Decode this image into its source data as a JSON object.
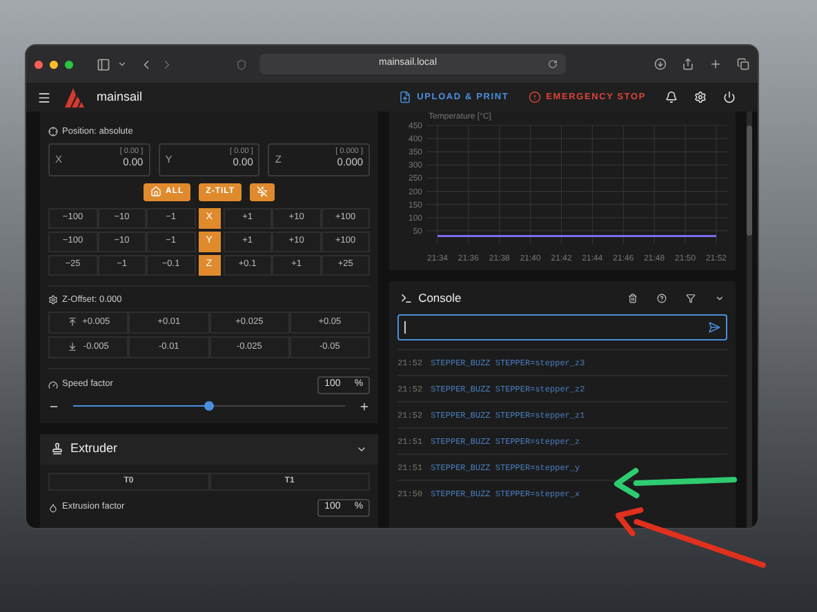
{
  "browser": {
    "url": "mainsail.local"
  },
  "app_bar": {
    "brand": "mainsail",
    "actions": [
      {
        "label": "UPLOAD & PRINT",
        "kind": "upload"
      },
      {
        "label": "EMERGENCY STOP",
        "kind": "stop"
      }
    ]
  },
  "toolhead": {
    "position_label": "Position: absolute",
    "axes": [
      {
        "label": "X",
        "target": "[ 0.00 ]",
        "value": "0.00"
      },
      {
        "label": "Y",
        "target": "[ 0.00 ]",
        "value": "0.00"
      },
      {
        "label": "Z",
        "target": "[ 0.000 ]",
        "value": "0.000"
      }
    ],
    "home_buttons": [
      {
        "kind": "home",
        "label": "ALL"
      },
      {
        "kind": "text",
        "label": "Z-TILT"
      },
      {
        "kind": "motors-off"
      }
    ],
    "jog_rows": [
      {
        "axis": "X",
        "minus": [
          "−100",
          "−10",
          "−1"
        ],
        "plus": [
          "+1",
          "+10",
          "+100"
        ]
      },
      {
        "axis": "Y",
        "minus": [
          "−100",
          "−10",
          "−1"
        ],
        "plus": [
          "+1",
          "+10",
          "+100"
        ]
      },
      {
        "axis": "Z",
        "minus": [
          "−25",
          "−1",
          "−0.1"
        ],
        "plus": [
          "+0.1",
          "+1",
          "+25"
        ]
      }
    ]
  },
  "z_offset": {
    "label": "Z-Offset: 0.000",
    "rows": [
      {
        "kind": "up",
        "steps": [
          "+0.005",
          "+0.01",
          "+0.025",
          "+0.05"
        ]
      },
      {
        "kind": "down",
        "steps": [
          "-0.005",
          "-0.01",
          "-0.025",
          "-0.05"
        ]
      }
    ]
  },
  "speed_factor": {
    "label": "Speed factor",
    "value": "100",
    "unit": "%",
    "level": 0.5
  },
  "extruder": {
    "title": "Extruder",
    "tools": [
      "T0",
      "T1"
    ],
    "extrusion_label": "Extrusion factor",
    "extrusion_value": "100",
    "extrusion_unit": "%"
  },
  "temperature": {
    "chart_data": {
      "type": "line",
      "grid": true,
      "ylabel": "Temperature [°C]",
      "categories": [
        "21:34",
        "21:36",
        "21:38",
        "21:40",
        "21:42",
        "21:44",
        "21:46",
        "21:48",
        "21:50",
        "21:52"
      ],
      "series": [
        {
          "color": "#7b6cf0",
          "values": [
            30,
            30,
            30,
            30,
            30,
            30,
            30,
            30,
            30,
            30
          ]
        }
      ],
      "ylim": [
        0,
        450
      ],
      "yticks": [
        50,
        100,
        150,
        200,
        250,
        300,
        350,
        400,
        450
      ]
    }
  },
  "console": {
    "title": "Console",
    "lines": [
      {
        "time": "21:52",
        "command": "STEPPER_BUZZ STEPPER=stepper_z3"
      },
      {
        "time": "21:52",
        "command": "STEPPER_BUZZ STEPPER=stepper_z2"
      },
      {
        "time": "21:52",
        "command": "STEPPER_BUZZ STEPPER=stepper_z1"
      },
      {
        "time": "21:51",
        "command": "STEPPER_BUZZ STEPPER=stepper_z"
      },
      {
        "time": "21:51",
        "command": "STEPPER_BUZZ STEPPER=stepper_y"
      },
      {
        "time": "21:50",
        "command": "STEPPER_BUZZ STEPPER=stepper_x"
      }
    ]
  },
  "arrows": [
    {
      "color": "#2ecc71"
    },
    {
      "color": "#e0301e"
    }
  ]
}
